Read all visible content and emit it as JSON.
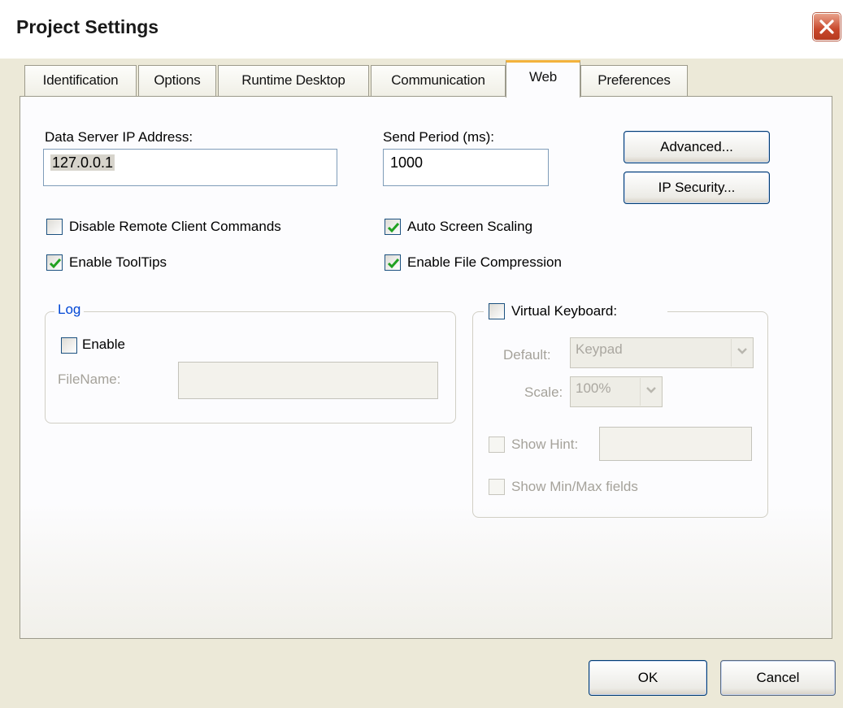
{
  "window": {
    "title": "Project Settings"
  },
  "tabs": [
    {
      "label": "Identification"
    },
    {
      "label": "Options"
    },
    {
      "label": "Runtime Desktop"
    },
    {
      "label": "Communication"
    },
    {
      "label": "Web"
    },
    {
      "label": "Preferences"
    }
  ],
  "active_tab": "Web",
  "web": {
    "data_server_ip_label": "Data Server IP Address:",
    "data_server_ip_value": "127.0.0.1",
    "send_period_label": "Send Period (ms):",
    "send_period_value": "1000",
    "advanced_label": "Advanced...",
    "ip_security_label": "IP Security...",
    "disable_remote_label": "Disable Remote Client Commands",
    "disable_remote_checked": false,
    "auto_scaling_label": "Auto Screen Scaling",
    "auto_scaling_checked": true,
    "tooltips_label": "Enable ToolTips",
    "tooltips_checked": true,
    "file_compression_label": "Enable File Compression",
    "file_compression_checked": true
  },
  "log": {
    "group_label": "Log",
    "enable_label": "Enable",
    "enable_checked": false,
    "filename_label": "FileName:",
    "filename_value": ""
  },
  "virtual_keyboard": {
    "label": "Virtual Keyboard:",
    "checked": false,
    "default_label": "Default:",
    "default_value": "Keypad",
    "scale_label": "Scale:",
    "scale_value": "100%",
    "show_hint_label": "Show Hint:",
    "show_hint_value": "",
    "show_minmax_label": "Show Min/Max fields"
  },
  "footer": {
    "ok_label": "OK",
    "cancel_label": "Cancel"
  },
  "colors": {
    "accent_tab": "#f3b33d",
    "check": "#21a121",
    "group_title": "#0046d5"
  },
  "icons": {
    "close": "close-icon",
    "check": "checkmark-icon",
    "dropdown": "chevron-down-icon"
  }
}
